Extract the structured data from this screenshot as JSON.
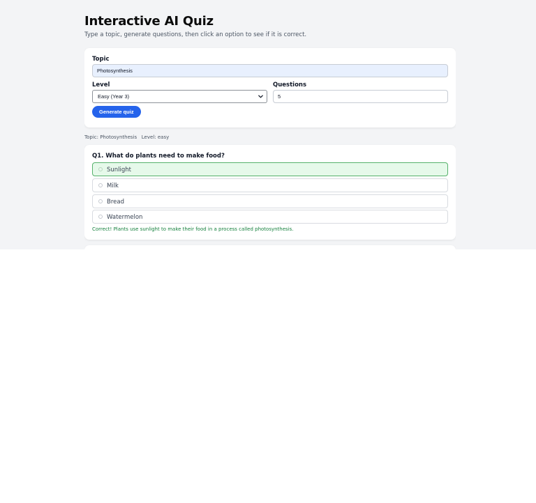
{
  "page": {
    "title": "Interactive AI Quiz",
    "subtitle": "Type a topic, generate questions, then click an option to see if it is correct."
  },
  "form": {
    "topic_label": "Topic",
    "topic_value": "Photosynthesis",
    "level_label": "Level",
    "level_selected": "Easy (Year 3)",
    "questions_label": "Questions",
    "questions_value": "5",
    "generate_label": "Generate quiz"
  },
  "meta": {
    "text": "Topic: Photosynthesis   Level: easy"
  },
  "questions": [
    {
      "title": "Q1. What do plants need to make food?",
      "options": [
        "Sunlight",
        "Milk",
        "Bread",
        "Watermelon"
      ],
      "selected_index": 0,
      "feedback": "Correct! Plants use sunlight to make their food in a process called photosynthesis."
    }
  ],
  "icons": {
    "select_chevron": "chevron-down-icon",
    "option_marker": "radio-icon"
  },
  "colors": {
    "primary": "#2563eb",
    "correct_bg": "#e6f9ea",
    "correct_border": "#55b16a",
    "feedback_text": "#15803d",
    "page_bg": "#f3f4f6"
  }
}
